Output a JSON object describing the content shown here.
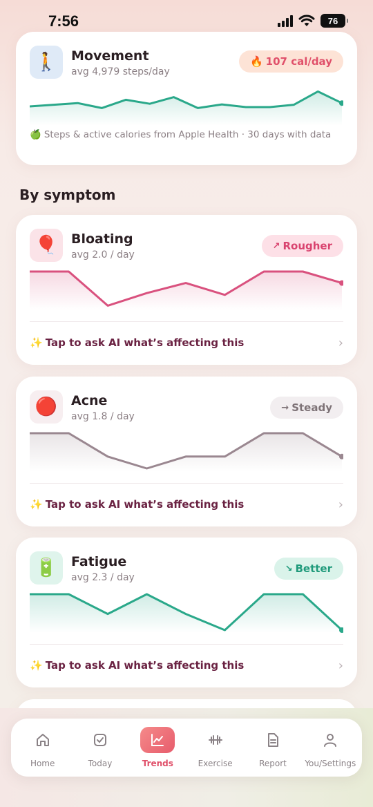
{
  "status": {
    "time": "7:56",
    "battery": "76"
  },
  "movement": {
    "icon": "walking-person-icon",
    "emoji": "🚶",
    "title": "Movement",
    "subtitle": "avg 4,979 steps/day",
    "pill": "107 cal/day",
    "pill_emoji": "🔥",
    "note_emoji": "🍏",
    "note": "Steps & active calories from Apple Health · 30 days with data",
    "color": "#2aa88a",
    "values": [
      0.5,
      0.45,
      0.4,
      0.55,
      0.3,
      0.42,
      0.22,
      0.55,
      0.44,
      0.52,
      0.52,
      0.45,
      0.05,
      0.4
    ]
  },
  "section_heading": "By symptom",
  "symptoms": [
    {
      "key": "bloating",
      "emoji": "🎈",
      "icon": "balloon-icon",
      "title": "Bloating",
      "subtitle": "avg 2.0 / day",
      "trend": "Rougher",
      "trend_arrow": "↗",
      "ask": "Tap to ask AI what’s affecting this",
      "color": "#d9517e",
      "tile_bg": "#fbe3e8",
      "pill_bg": "#fde0e7",
      "pill_fg": "#d9436f",
      "values": [
        0.0,
        0.0,
        0.95,
        0.6,
        0.32,
        0.65,
        0.0,
        0.0,
        0.32
      ]
    },
    {
      "key": "acne",
      "emoji": "🔴",
      "icon": "red-circle-icon",
      "title": "Acne",
      "subtitle": "avg 1.8 / day",
      "trend": "Steady",
      "trend_arrow": "→",
      "ask": "Tap to ask AI what’s affecting this",
      "color": "#9a8790",
      "tile_bg": "#f7eef0",
      "pill_bg": "#f2eef0",
      "pill_fg": "#7d7276",
      "values": [
        0.0,
        0.0,
        0.65,
        0.98,
        0.65,
        0.65,
        0.0,
        0.0,
        0.65
      ]
    },
    {
      "key": "fatigue",
      "emoji": "🔋",
      "icon": "battery-icon",
      "title": "Fatigue",
      "subtitle": "avg 2.3 / day",
      "trend": "Better",
      "trend_arrow": "↘",
      "ask": "Tap to ask AI what’s affecting this",
      "color": "#2aa88a",
      "tile_bg": "#dff4ec",
      "pill_bg": "#daf3ea",
      "pill_fg": "#1f9a7b",
      "values": [
        0.0,
        0.0,
        0.55,
        0.0,
        0.55,
        1.0,
        0.0,
        0.0,
        1.0
      ]
    }
  ],
  "tabs": [
    {
      "label": "Home",
      "icon": "home-icon",
      "active": false
    },
    {
      "label": "Today",
      "icon": "checkbox-icon",
      "active": false
    },
    {
      "label": "Trends",
      "icon": "chart-line-icon",
      "active": true
    },
    {
      "label": "Exercise",
      "icon": "dumbbell-icon",
      "active": false
    },
    {
      "label": "Report",
      "icon": "document-icon",
      "active": false
    },
    {
      "label": "You/Settings",
      "icon": "person-icon",
      "active": false
    }
  ]
}
